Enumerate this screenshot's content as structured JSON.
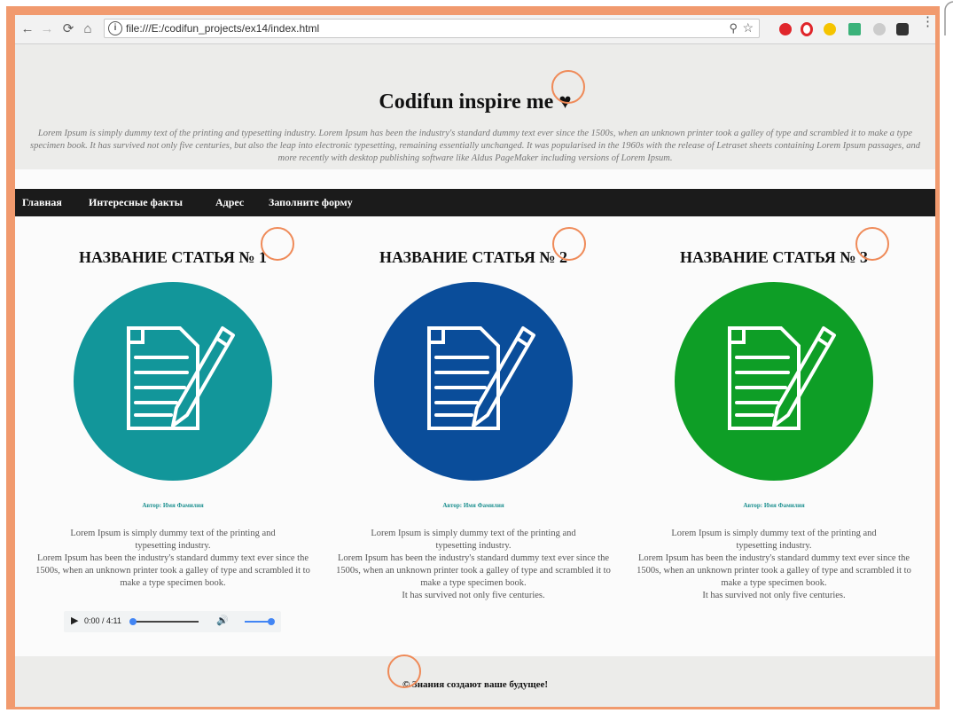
{
  "browser": {
    "url": "file:///E:/codifun_projects/ex14/index.html",
    "icons": [
      "back-icon",
      "forward-icon",
      "reload-icon",
      "home-icon",
      "info-icon",
      "zoom-icon",
      "bookmark-star-icon",
      "menu-icon"
    ],
    "extension_colors": [
      "#e0262b",
      "#e0262b",
      "#f5c400",
      "#3bb27a",
      "#cccccc",
      "#333333"
    ]
  },
  "header": {
    "title": "Codifun inspire me ♥",
    "lead": "Lorem Ipsum is simply dummy text of the printing and typesetting industry. Lorem Ipsum has been the industry's standard dummy text ever since the 1500s, when an unknown printer took a galley of type and scrambled it to make a type specimen book. It has survived not only five centuries, but also the leap into electronic typesetting, remaining essentially unchanged. It was popularised in the 1960s with the release of Letraset sheets containing Lorem Ipsum passages, and more recently with desktop publishing software like Aldus PageMaker including versions of Lorem Ipsum."
  },
  "nav": {
    "items": [
      "Главная",
      "Интересные факты",
      "Адрес",
      "Заполните форму"
    ]
  },
  "articles": [
    {
      "title": "НАЗВАНИЕ СТАТЬЯ № 1",
      "author": "Автор: Имя Фамилия",
      "color": "#12969a",
      "p1": "Lorem Ipsum is simply dummy text of the printing and typesetting industry.",
      "p2": "Lorem Ipsum has been the industry's standard dummy text ever since the 1500s, when an unknown printer took a galley of type and scrambled it to make a type specimen book.",
      "p3": ""
    },
    {
      "title": "НАЗВАНИЕ СТАТЬЯ № 2",
      "author": "Автор: Имя Фамилия",
      "color": "#0a4d9a",
      "p1": "Lorem Ipsum is simply dummy text of the printing and typesetting industry.",
      "p2": "Lorem Ipsum has been the industry's standard dummy text ever since the 1500s, when an unknown printer took a galley of type and scrambled it to make a type specimen book.",
      "p3": "It has survived not only five centuries."
    },
    {
      "title": "НАЗВАНИЕ СТАТЬЯ № 3",
      "author": "Автор: Имя Фамилия",
      "color": "#0e9e26",
      "p1": "Lorem Ipsum is simply dummy text of the printing and typesetting industry.",
      "p2": "Lorem Ipsum has been the industry's standard dummy text ever since the 1500s, when an unknown printer took a galley of type and scrambled it to make a type specimen book.",
      "p3": "It has survived not only five centuries."
    }
  ],
  "audio": {
    "time": "0:00 / 4:11",
    "progress": 0,
    "volume": 1.0,
    "accent": "#4285f4"
  },
  "footer": {
    "text": "© Знания создают ваше будущее!"
  },
  "annotation_color": "#ef8a58"
}
